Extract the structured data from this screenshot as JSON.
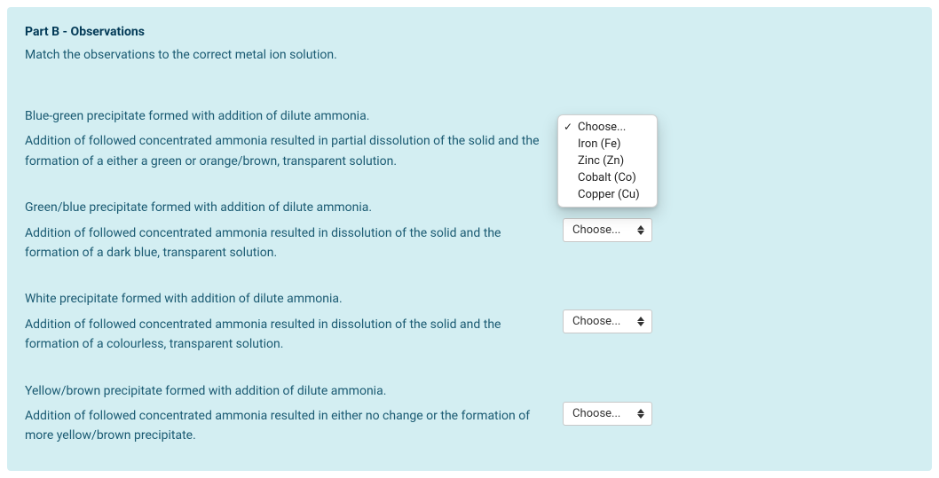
{
  "heading": "Part B - Observations",
  "instructions": "Match the observations to the correct metal ion solution.",
  "placeholder": "Choose...",
  "options": [
    "Choose...",
    "Iron (Fe)",
    "Zinc (Zn)",
    "Cobalt (Co)",
    "Copper (Cu)"
  ],
  "rows": [
    {
      "line1": "Blue-green precipitate formed with addition of dilute ammonia.",
      "line2": "Addition of followed concentrated ammonia resulted in partial dissolution of the solid and the formation of a either a green or orange/brown, transparent solution."
    },
    {
      "line1": "Green/blue precipitate formed with addition of dilute ammonia.",
      "line2": "Addition of followed concentrated ammonia resulted in dissolution of the solid and the formation of a dark blue, transparent solution."
    },
    {
      "line1": "White precipitate formed with addition of dilute ammonia.",
      "line2": "Addition of followed concentrated ammonia resulted in dissolution of the solid and the formation of a colourless, transparent solution."
    },
    {
      "line1": "Yellow/brown precipitate formed with addition of dilute ammonia.",
      "line2": "Addition of followed concentrated ammonia resulted in either no change or the formation of more yellow/brown precipitate."
    }
  ]
}
